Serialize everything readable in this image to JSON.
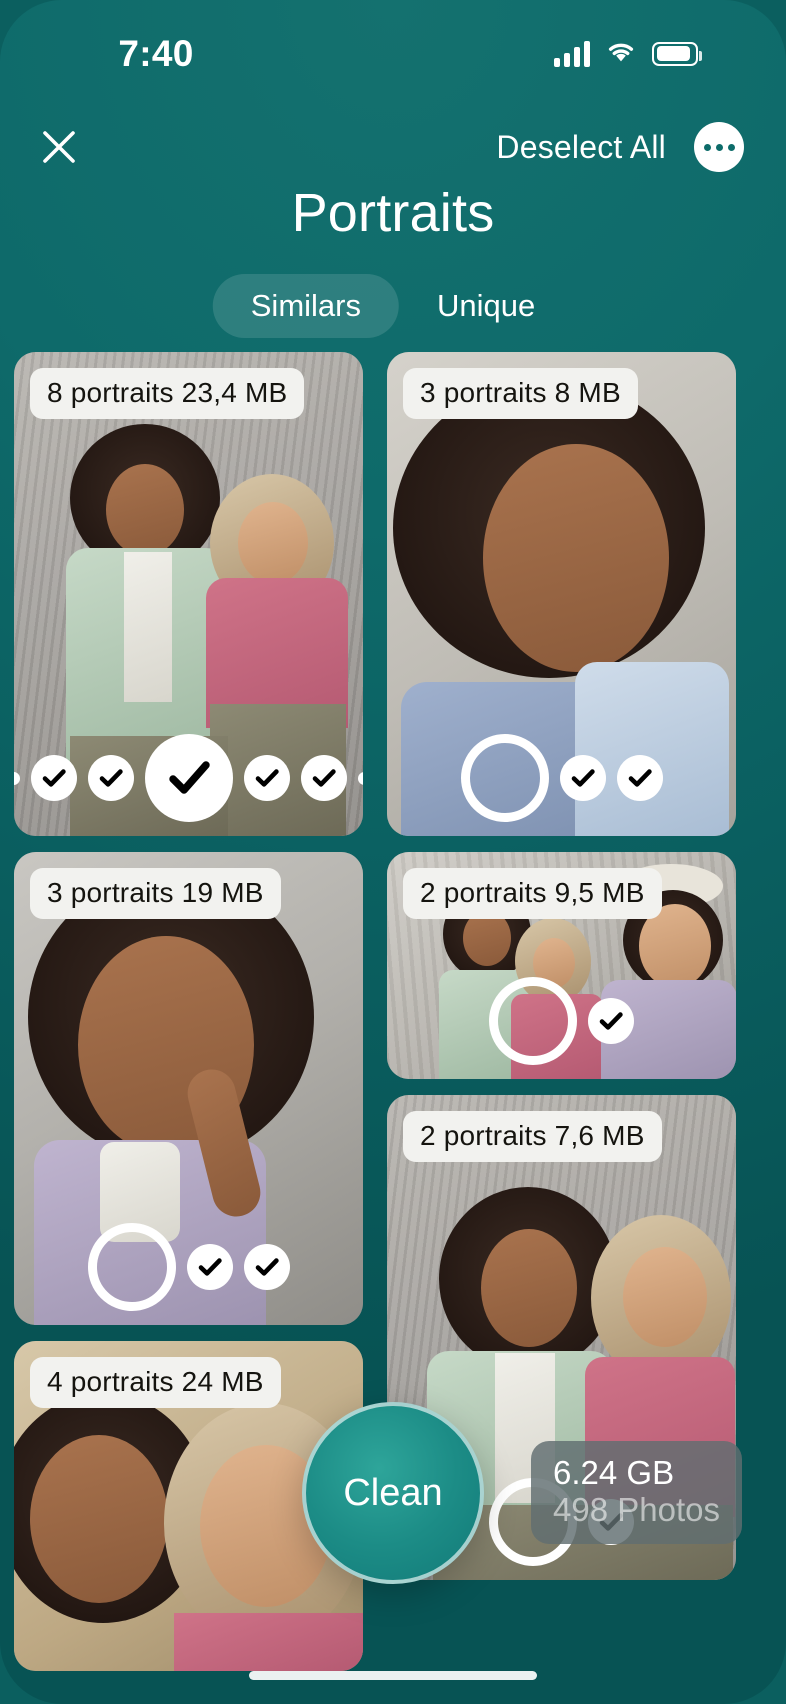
{
  "status_bar": {
    "time": "7:40",
    "cellular_icon": "cellular-signal-icon",
    "wifi_icon": "wifi-icon",
    "battery_icon": "battery-icon"
  },
  "nav": {
    "close_icon": "close-icon",
    "deselect_all_label": "Deselect All",
    "more_icon": "more-options-icon"
  },
  "title": "Portraits",
  "tabs": [
    {
      "label": "Similars",
      "active": true
    },
    {
      "label": "Unique",
      "active": false
    }
  ],
  "cards": [
    {
      "id": "card-1",
      "label": "8 portraits 23,4 MB",
      "column": "left",
      "selected_count": 4,
      "total": 6,
      "main_selected": true
    },
    {
      "id": "card-2",
      "label": "3 portraits 8 MB",
      "column": "right",
      "selected_count": 2,
      "total": 3,
      "main_selected": false
    },
    {
      "id": "card-3",
      "label": "3 portraits 19 MB",
      "column": "left",
      "selected_count": 2,
      "total": 3,
      "main_selected": false
    },
    {
      "id": "card-4",
      "label": "2 portraits 9,5 MB",
      "column": "right",
      "selected_count": 1,
      "total": 2,
      "main_selected": false
    },
    {
      "id": "card-5",
      "label": "2 portraits 7,6 MB",
      "column": "right",
      "selected_count": 1,
      "total": 2,
      "main_selected": false
    },
    {
      "id": "card-6",
      "label": "4 portraits 24 MB",
      "column": "left",
      "selected_count": 0,
      "total": 4,
      "main_selected": false
    }
  ],
  "clean_button": {
    "label": "Clean"
  },
  "storage_badge": {
    "size": "6.24 GB",
    "count": "498 Photos"
  },
  "colors": {
    "background_top": "#14716f",
    "background_bottom": "#075354",
    "accent": "#1c8c86",
    "chip_background": "#f2f2ef",
    "chip_text": "#15140f",
    "check_background": "#ffffff",
    "check_mark": "#000000"
  }
}
